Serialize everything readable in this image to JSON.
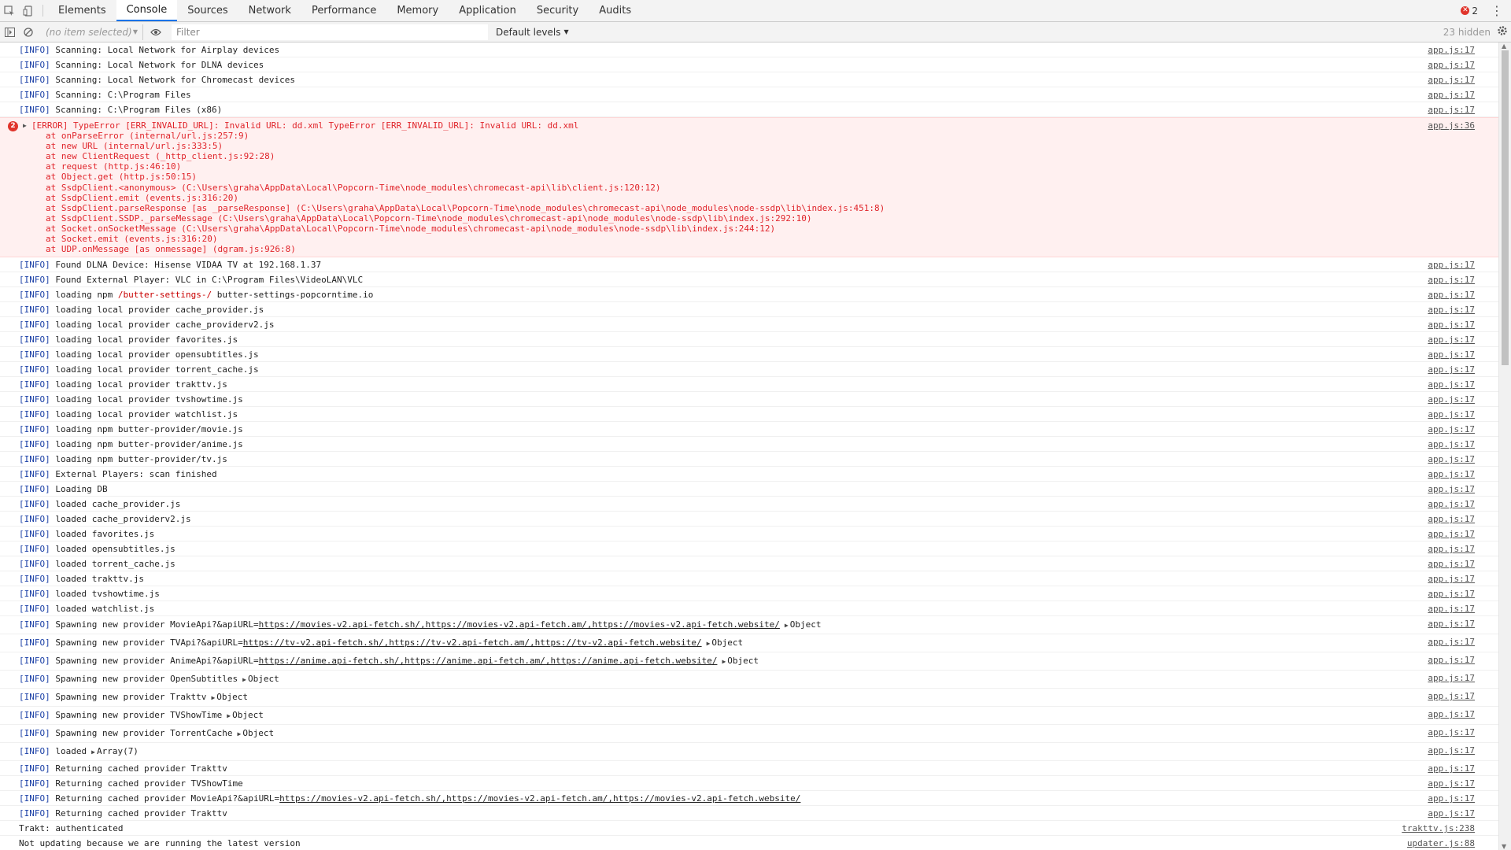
{
  "tabs": [
    "Elements",
    "Console",
    "Sources",
    "Network",
    "Performance",
    "Memory",
    "Application",
    "Security",
    "Audits"
  ],
  "active_tab": "Console",
  "error_badge": "2",
  "toolbar": {
    "context": "(no item selected)",
    "filter_placeholder": "Filter",
    "levels": "Default levels",
    "hidden": "23 hidden"
  },
  "info_rows_top": [
    {
      "text": "Scanning: Local Network for Airplay devices",
      "src": "app.js:17"
    },
    {
      "text": "Scanning: Local Network for DLNA devices",
      "src": "app.js:17"
    },
    {
      "text": "Scanning: Local Network for Chromecast devices",
      "src": "app.js:17"
    },
    {
      "text": "Scanning: C:\\Program Files",
      "src": "app.js:17"
    },
    {
      "text": "Scanning: C:\\Program Files (x86)",
      "src": "app.js:17"
    }
  ],
  "error": {
    "count": "2",
    "src": "app.js:36",
    "head": "[ERROR] TypeError [ERR_INVALID_URL]: Invalid URL: dd.xml TypeError [ERR_INVALID_URL]: Invalid URL: dd.xml",
    "stack": [
      "at onParseError (internal/url.js:257:9)",
      "at new URL (internal/url.js:333:5)",
      "at new ClientRequest (_http_client.js:92:28)",
      "at request (http.js:46:10)",
      "at Object.get (http.js:50:15)",
      "at SsdpClient.<anonymous> (C:\\Users\\graha\\AppData\\Local\\Popcorn-Time\\node_modules\\chromecast-api\\lib\\client.js:120:12)",
      "at SsdpClient.emit (events.js:316:20)",
      "at SsdpClient.parseResponse [as _parseResponse] (C:\\Users\\graha\\AppData\\Local\\Popcorn-Time\\node_modules\\chromecast-api\\node_modules\\node-ssdp\\lib\\index.js:451:8)",
      "at SsdpClient.SSDP._parseMessage (C:\\Users\\graha\\AppData\\Local\\Popcorn-Time\\node_modules\\chromecast-api\\node_modules\\node-ssdp\\lib\\index.js:292:10)",
      "at Socket.onSocketMessage (C:\\Users\\graha\\AppData\\Local\\Popcorn-Time\\node_modules\\chromecast-api\\node_modules\\node-ssdp\\lib\\index.js:244:12)",
      "at Socket.emit (events.js:316:20)",
      "at UDP.onMessage [as onmessage] (dgram.js:926:8)"
    ]
  },
  "info_rows_mid": [
    {
      "text": "Found DLNA Device: Hisense VIDAA TV at 192.168.1.37",
      "src": "app.js:17"
    },
    {
      "text": "Found External Player: VLC in C:\\Program Files\\VideoLAN\\VLC",
      "src": "app.js:17"
    },
    {
      "pre": "loading npm ",
      "red": "/butter-settings-/",
      "post": " butter-settings-popcorntime.io",
      "src": "app.js:17"
    },
    {
      "text": "loading local provider cache_provider.js",
      "src": "app.js:17"
    },
    {
      "text": "loading local provider cache_providerv2.js",
      "src": "app.js:17"
    },
    {
      "text": "loading local provider favorites.js",
      "src": "app.js:17"
    },
    {
      "text": "loading local provider opensubtitles.js",
      "src": "app.js:17"
    },
    {
      "text": "loading local provider torrent_cache.js",
      "src": "app.js:17"
    },
    {
      "text": "loading local provider trakttv.js",
      "src": "app.js:17"
    },
    {
      "text": "loading local provider tvshowtime.js",
      "src": "app.js:17"
    },
    {
      "text": "loading local provider watchlist.js",
      "src": "app.js:17"
    },
    {
      "text": "loading npm butter-provider/movie.js",
      "src": "app.js:17"
    },
    {
      "text": "loading npm butter-provider/anime.js",
      "src": "app.js:17"
    },
    {
      "text": "loading npm butter-provider/tv.js",
      "src": "app.js:17"
    },
    {
      "text": "External Players: scan finished",
      "src": "app.js:17"
    },
    {
      "text": "Loading DB",
      "src": "app.js:17"
    },
    {
      "text": "loaded cache_provider.js",
      "src": "app.js:17"
    },
    {
      "text": "loaded cache_providerv2.js",
      "src": "app.js:17"
    },
    {
      "text": "loaded favorites.js",
      "src": "app.js:17"
    },
    {
      "text": "loaded opensubtitles.js",
      "src": "app.js:17"
    },
    {
      "text": "loaded torrent_cache.js",
      "src": "app.js:17"
    },
    {
      "text": "loaded trakttv.js",
      "src": "app.js:17"
    },
    {
      "text": "loaded tvshowtime.js",
      "src": "app.js:17"
    },
    {
      "text": "loaded watchlist.js",
      "src": "app.js:17"
    }
  ],
  "spawn_rows": [
    {
      "pre": "Spawning new provider MovieApi?&apiURL=",
      "url": "https://movies-v2.api-fetch.sh/,https://movies-v2.api-fetch.am/,https://movies-v2.api-fetch.website/",
      "obj": "Object",
      "src": "app.js:17"
    },
    {
      "pre": "Spawning new provider TVApi?&apiURL=",
      "url": "https://tv-v2.api-fetch.sh/,https://tv-v2.api-fetch.am/,https://tv-v2.api-fetch.website/",
      "obj": "Object",
      "src": "app.js:17"
    },
    {
      "pre": "Spawning new provider AnimeApi?&apiURL=",
      "url": "https://anime.api-fetch.sh/,https://anime.api-fetch.am/,https://anime.api-fetch.website/",
      "obj": "Object",
      "src": "app.js:17"
    },
    {
      "pre": "Spawning new provider OpenSubtitles",
      "url": "",
      "obj": "Object",
      "src": "app.js:17"
    },
    {
      "pre": "Spawning new provider Trakttv",
      "url": "",
      "obj": "Object",
      "src": "app.js:17"
    },
    {
      "pre": "Spawning new provider TVShowTime",
      "url": "",
      "obj": "Object",
      "src": "app.js:17"
    },
    {
      "pre": "Spawning new provider TorrentCache",
      "url": "",
      "obj": "Object",
      "src": "app.js:17"
    },
    {
      "pre": "loaded",
      "url": "",
      "obj": "Array(7)",
      "src": "app.js:17"
    }
  ],
  "info_rows_end": [
    {
      "pre": "Returning cached provider Trakttv",
      "url": "",
      "src": "app.js:17"
    },
    {
      "pre": "Returning cached provider TVShowTime",
      "url": "",
      "src": "app.js:17"
    },
    {
      "pre": "Returning cached provider MovieApi?&apiURL=",
      "url": "https://movies-v2.api-fetch.sh/,https://movies-v2.api-fetch.am/,https://movies-v2.api-fetch.website/",
      "src": "app.js:17"
    },
    {
      "pre": "Returning cached provider Trakttv",
      "url": "",
      "src": "app.js:17"
    }
  ],
  "plain_rows": [
    {
      "text": "Trakt: authenticated",
      "src": "trakttv.js:238"
    },
    {
      "text": "Not updating because we are running the latest version",
      "src": "updater.js:88"
    }
  ],
  "level_tag": "[INFO]"
}
